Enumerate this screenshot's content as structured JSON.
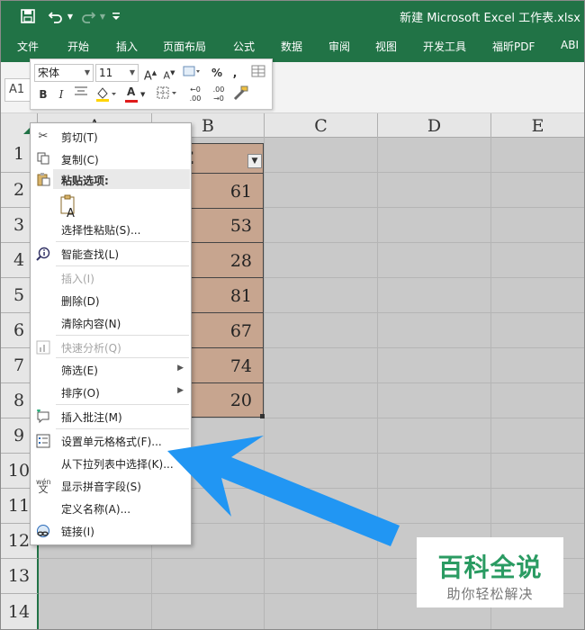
{
  "window": {
    "title": "新建 Microsoft Excel 工作表.xlsx",
    "save_icon": "save-icon",
    "undo_icon": "undo-icon",
    "redo_icon": "redo-icon",
    "customize_icon": "customize-quick-access-icon"
  },
  "ribbon": {
    "tabs": [
      "文件",
      "开始",
      "插入",
      "页面布局",
      "公式",
      "数据",
      "审阅",
      "视图",
      "开发工具",
      "福昕PDF",
      "ABI"
    ]
  },
  "formula_bar": {
    "name_box": "A1"
  },
  "mini_toolbar": {
    "font_name": "宋体",
    "font_size": "11",
    "increase_font": "A",
    "decrease_font": "A",
    "percent": "%",
    "comma": ",",
    "bold": "B",
    "italic": "I",
    "font_color": "A",
    "inc_decimal": ".00",
    "dec_decimal": ".00"
  },
  "grid": {
    "columns": [
      "A",
      "B",
      "C",
      "D",
      "E"
    ],
    "rows": [
      "1",
      "2",
      "3",
      "4",
      "5",
      "6",
      "7",
      "8",
      "9",
      "10",
      "11",
      "12",
      "13",
      "14"
    ],
    "header_cell_fragment": "E",
    "values": [
      "61",
      "53",
      "28",
      "81",
      "67",
      "74",
      "20"
    ],
    "cell_color": "#c7a58f"
  },
  "context_menu": {
    "cut": "剪切(T)",
    "copy": "复制(C)",
    "paste_options": "粘贴选项:",
    "paste_special": "选择性粘贴(S)...",
    "smart_lookup": "智能查找(L)",
    "insert": "插入(I)",
    "delete": "删除(D)",
    "clear_contents": "清除内容(N)",
    "quick_analysis": "快速分析(Q)",
    "filter": "筛选(E)",
    "sort": "排序(O)",
    "insert_comment": "插入批注(M)",
    "format_cells": "设置单元格格式(F)...",
    "pick_from_list": "从下拉列表中选择(K)...",
    "phonetic": "显示拼音字段(S)",
    "define_name": "定义名称(A)...",
    "link": "链接(I)"
  },
  "annotation": {
    "arrow_color": "#2196f3"
  },
  "watermark": {
    "title": "百科全说",
    "subtitle": "助你轻松解决"
  }
}
